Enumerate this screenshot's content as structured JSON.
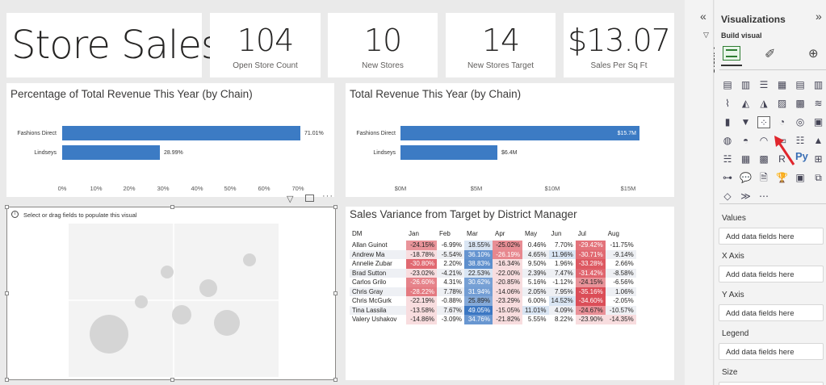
{
  "kpis": [
    {
      "value": "Store Sales",
      "label": ""
    },
    {
      "value": "104",
      "label": "Open Store Count"
    },
    {
      "value": "10",
      "label": "New Stores"
    },
    {
      "value": "14",
      "label": "New Stores Target"
    },
    {
      "value": "$13.07",
      "label": "Sales Per Sq Ft"
    }
  ],
  "pct_chart": {
    "title": "Percentage of Total Revenue This Year (by Chain)",
    "categories": [
      "Fashions Direct",
      "Lindseys"
    ],
    "value_labels": [
      "71.01%",
      "28.99%"
    ],
    "ticks": [
      "0%",
      "10%",
      "20%",
      "30%",
      "40%",
      "50%",
      "60%",
      "70%"
    ]
  },
  "rev_chart": {
    "title": "Total Revenue This Year (by Chain)",
    "categories": [
      "Fashions Direct",
      "Lindseys"
    ],
    "value_labels": [
      "$15.7M",
      "$6.4M"
    ],
    "ticks": [
      "$0M",
      "$5M",
      "$10M",
      "$15M"
    ]
  },
  "scatter": {
    "placeholder": "Select or drag fields to populate this visual"
  },
  "matrix": {
    "title": "Sales Variance from Target by District Manager",
    "columns": [
      "DM",
      "Jan",
      "Feb",
      "Mar",
      "Apr",
      "May",
      "Jun",
      "Jul",
      "Aug"
    ],
    "rows": [
      [
        "Allan Guinot",
        "-24.15%",
        "-6.99%",
        "18.55%",
        "-25.02%",
        "0.46%",
        "7.70%",
        "-29.42%",
        "-11.75%"
      ],
      [
        "Andrew Ma",
        "-18.78%",
        "-5.54%",
        "36.10%",
        "-26.19%",
        "4.65%",
        "11.96%",
        "-30.71%",
        "-9.14%"
      ],
      [
        "Annelie Zubar",
        "-30.80%",
        "2.20%",
        "38.83%",
        "-16.34%",
        "9.50%",
        "1.96%",
        "-33.28%",
        "2.66%"
      ],
      [
        "Brad Sutton",
        "-23.02%",
        "-4.21%",
        "22.53%",
        "-22.00%",
        "2.39%",
        "7.47%",
        "-31.42%",
        "-8.58%"
      ],
      [
        "Carlos Grilo",
        "-26.60%",
        "4.31%",
        "30.62%",
        "-20.85%",
        "5.16%",
        "-1.12%",
        "-24.15%",
        "-6.56%"
      ],
      [
        "Chris Gray",
        "-28.22%",
        "7.78%",
        "31.94%",
        "-14.06%",
        "2.05%",
        "7.95%",
        "-35.16%",
        "1.06%"
      ],
      [
        "Chris McGurk",
        "-22.19%",
        "-0.88%",
        "25.89%",
        "-23.29%",
        "6.00%",
        "14.52%",
        "-34.60%",
        "-2.05%"
      ],
      [
        "Tina Lassila",
        "-13.58%",
        "7.67%",
        "49.05%",
        "-15.05%",
        "11.01%",
        "4.09%",
        "-24.67%",
        "-10.57%"
      ],
      [
        "Valery Ushakov",
        "-14.86%",
        "-3.09%",
        "34.76%",
        "-21.82%",
        "5.55%",
        "8.22%",
        "-23.90%",
        "-14.35%"
      ]
    ]
  },
  "pane": {
    "filters_label": "Filters",
    "title": "Visualizations",
    "build_visual": "Build visual",
    "py_label": "Py",
    "fields": [
      {
        "label": "Values",
        "placeholder": "Add data fields here"
      },
      {
        "label": "X Axis",
        "placeholder": "Add data fields here"
      },
      {
        "label": "Y Axis",
        "placeholder": "Add data fields here"
      },
      {
        "label": "Legend",
        "placeholder": "Add data fields here"
      },
      {
        "label": "Size",
        "placeholder": ""
      }
    ]
  },
  "colors": {
    "bar": "#3c7bc4",
    "positive": "#2f6fbf",
    "negative": "#d9434e"
  }
}
